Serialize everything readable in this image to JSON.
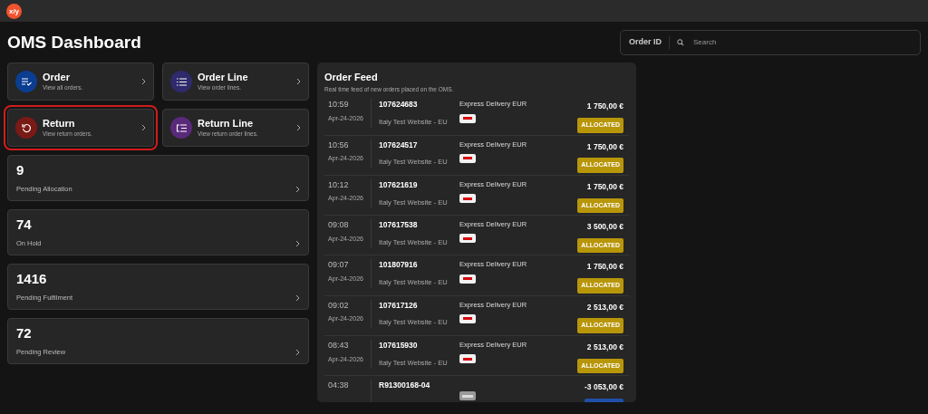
{
  "app": {
    "logo": "x/y"
  },
  "title": "OMS Dashboard",
  "search": {
    "label": "Order ID",
    "placeholder": "Search"
  },
  "tiles": [
    {
      "kind": "order",
      "title": "Order",
      "subtitle": "View all orders.",
      "color": "#0b3d91",
      "highlighted": false
    },
    {
      "kind": "order_line",
      "title": "Order Line",
      "subtitle": "View order lines.",
      "color": "#2e2a6b",
      "highlighted": false
    },
    {
      "kind": "return",
      "title": "Return",
      "subtitle": "View return orders.",
      "color": "#7a1a16",
      "highlighted": true
    },
    {
      "kind": "return_line",
      "title": "Return Line",
      "subtitle": "View return order lines.",
      "color": "#5a2a7a",
      "highlighted": false
    }
  ],
  "stats": [
    {
      "value": "9",
      "label": "Pending Allocation"
    },
    {
      "value": "74",
      "label": "On Hold"
    },
    {
      "value": "1416",
      "label": "Pending Fulfilment"
    },
    {
      "value": "72",
      "label": "Pending Review"
    }
  ],
  "feed": {
    "title": "Order Feed",
    "subtitle": "Real time feed of new orders placed on the OMS.",
    "rows": [
      {
        "kind": "courier",
        "time": "10:59",
        "date": "Apr-24-2026",
        "order_id": "107624683",
        "site": "Italy Test Website - EU",
        "delivery": "Express Delivery EUR",
        "amount": "1 750,00 €",
        "status": "ALLOCATED",
        "color": "#b8960a"
      },
      {
        "kind": "courier",
        "time": "10:56",
        "date": "Apr-24-2026",
        "order_id": "107624517",
        "site": "Italy Test Website - EU",
        "delivery": "Express Delivery EUR",
        "amount": "1 750,00 €",
        "status": "ALLOCATED",
        "color": "#b8960a"
      },
      {
        "kind": "courier",
        "time": "10:12",
        "date": "Apr-24-2026",
        "order_id": "107621619",
        "site": "Italy Test Website - EU",
        "delivery": "Express Delivery EUR",
        "amount": "1 750,00 €",
        "status": "ALLOCATED",
        "color": "#b8960a"
      },
      {
        "kind": "courier",
        "time": "09:08",
        "date": "Apr-24-2026",
        "order_id": "107617538",
        "site": "Italy Test Website - EU",
        "delivery": "Express Delivery EUR",
        "amount": "3 500,00 €",
        "status": "ALLOCATED",
        "color": "#b8960a"
      },
      {
        "kind": "courier",
        "time": "09:07",
        "date": "Apr-24-2026",
        "order_id": "101807916",
        "site": "Italy Test Website - EU",
        "delivery": "Express Delivery EUR",
        "amount": "1 750,00 €",
        "status": "ALLOCATED",
        "color": "#b8960a"
      },
      {
        "kind": "courier",
        "time": "09:02",
        "date": "Apr-24-2026",
        "order_id": "107617126",
        "site": "Italy Test Website - EU",
        "delivery": "Express Delivery EUR",
        "amount": "2 513,00 €",
        "status": "ALLOCATED",
        "color": "#b8960a"
      },
      {
        "kind": "courier",
        "time": "08:43",
        "date": "Apr-24-2026",
        "order_id": "107615930",
        "site": "Italy Test Website - EU",
        "delivery": "Express Delivery EUR",
        "amount": "2 513,00 €",
        "status": "ALLOCATED",
        "color": "#b8960a"
      },
      {
        "kind": "truck",
        "time": "04:38",
        "order_id": "R91300168-04",
        "amount": "-3 053,00 €",
        "color": "#1f4fa8"
      }
    ]
  }
}
